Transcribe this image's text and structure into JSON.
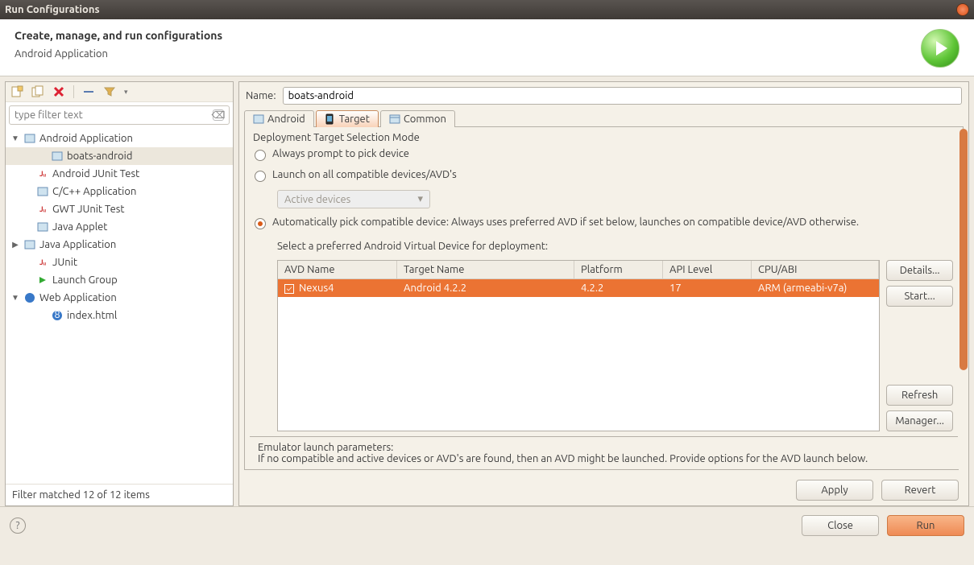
{
  "window": {
    "title": "Run Configurations"
  },
  "header": {
    "title": "Create, manage, and run configurations",
    "subtitle": "Android Application"
  },
  "filter": {
    "placeholder": "type filter text"
  },
  "tree": {
    "items": [
      {
        "label": "Android Application",
        "expandable": true,
        "expanded": true,
        "children": [
          {
            "label": "boats-android",
            "selected": true
          }
        ]
      },
      {
        "label": "Android JUnit Test"
      },
      {
        "label": "C/C++ Application"
      },
      {
        "label": "GWT JUnit Test"
      },
      {
        "label": "Java Applet"
      },
      {
        "label": "Java Application",
        "expandable": true,
        "expanded": false
      },
      {
        "label": "JUnit"
      },
      {
        "label": "Launch Group"
      },
      {
        "label": "Web Application",
        "expandable": true,
        "expanded": true,
        "children": [
          {
            "label": "index.html"
          }
        ]
      }
    ]
  },
  "filter_status": "Filter matched 12 of 12 items",
  "name": {
    "label": "Name:",
    "value": "boats-android"
  },
  "tabs": {
    "android": "Android",
    "target": "Target",
    "common": "Common"
  },
  "deployment": {
    "group": "Deployment Target Selection Mode",
    "opt1": "Always prompt to pick device",
    "opt2": "Launch on all compatible devices/AVD's",
    "combo": "Active devices",
    "opt3": "Automatically pick compatible device: Always uses preferred AVD if set below, launches on compatible device/AVD otherwise.",
    "sub": "Select a preferred Android Virtual Device for deployment:"
  },
  "avd": {
    "headers": {
      "name": "AVD Name",
      "target": "Target Name",
      "platform": "Platform",
      "api": "API Level",
      "cpu": "CPU/ABI"
    },
    "rows": [
      {
        "name": "Nexus4",
        "target": "Android 4.2.2",
        "platform": "4.2.2",
        "api": "17",
        "cpu": "ARM (armeabi-v7a)",
        "checked": true
      }
    ]
  },
  "buttons": {
    "details": "Details...",
    "start": "Start...",
    "refresh": "Refresh",
    "manager": "Manager...",
    "apply": "Apply",
    "revert": "Revert",
    "close": "Close",
    "run": "Run"
  },
  "emulator": {
    "title": "Emulator launch parameters:",
    "text": "If no compatible and active devices or AVD's are found, then an AVD might be launched. Provide options for the AVD launch below."
  }
}
